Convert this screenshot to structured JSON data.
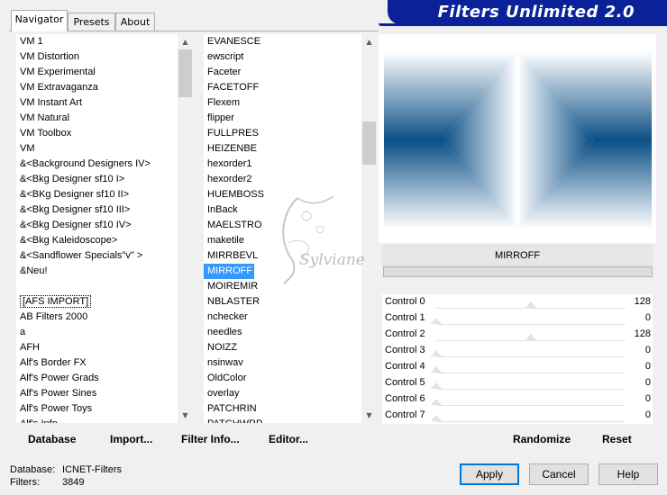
{
  "banner": {
    "title": "Filters Unlimited 2.0"
  },
  "tabs": [
    "Navigator",
    "Presets",
    "About"
  ],
  "categories": [
    "VM 1",
    "VM Distortion",
    "VM Experimental",
    "VM Extravaganza",
    "VM Instant Art",
    "VM Natural",
    "VM Toolbox",
    "VM",
    "&<Background Designers IV>",
    "&<Bkg Designer sf10 I>",
    "&<BKg Designer sf10 II>",
    "&<Bkg Designer sf10 III>",
    "&<Bkg Designer sf10 IV>",
    "&<Bkg Kaleidoscope>",
    "&<Sandflower Specials\"v\" >",
    "&Neu!",
    "",
    "[AFS IMPORT]",
    "AB Filters 2000",
    "a",
    "AFH",
    "Alf's Border FX",
    "Alf's Power Grads",
    "Alf's Power Sines",
    "Alf's Power Toys",
    "Alf's Info"
  ],
  "filters": [
    "EVANESCE",
    "ewscript",
    "Faceter",
    "FACETOFF",
    "Flexem",
    "flipper",
    "FULLPRES",
    "HEIZENBE",
    "hexorder1",
    "hexorder2",
    "HUEMBOSS",
    "InBack",
    "MAELSTRO",
    "maketile",
    "MIRRBEVL",
    "MIRROFF",
    "MOIREMIR",
    "NBLASTER",
    "nchecker",
    "needles",
    "NOIZZ",
    "nsinwav",
    "OldColor",
    "overlay",
    "PATCHRIN",
    "PATCHWRP"
  ],
  "selected_filter": "MIRROFF",
  "left_buttons": {
    "database": "Database",
    "import": "Import...",
    "filter_info": "Filter Info...",
    "editor": "Editor..."
  },
  "filter_name": "MIRROFF",
  "controls": [
    {
      "label": "Control 0",
      "value": "128"
    },
    {
      "label": "Control 1",
      "value": "0"
    },
    {
      "label": "Control 2",
      "value": "128"
    },
    {
      "label": "Control 3",
      "value": "0"
    },
    {
      "label": "Control 4",
      "value": "0"
    },
    {
      "label": "Control 5",
      "value": "0"
    },
    {
      "label": "Control 6",
      "value": "0"
    },
    {
      "label": "Control 7",
      "value": "0"
    }
  ],
  "right_buttons": {
    "randomize": "Randomize",
    "reset": "Reset"
  },
  "footer": {
    "database_label": "Database:",
    "database_value": "ICNET-Filters",
    "filters_label": "Filters:",
    "filters_value": "3849",
    "apply": "Apply",
    "cancel": "Cancel",
    "help": "Help"
  },
  "watermark": {
    "text": "Sylviane"
  },
  "colors": {
    "banner": "#0a2199",
    "accent": "#3399ff",
    "preview_dark": "#0b4f86",
    "preview_light": "#ffffff"
  }
}
